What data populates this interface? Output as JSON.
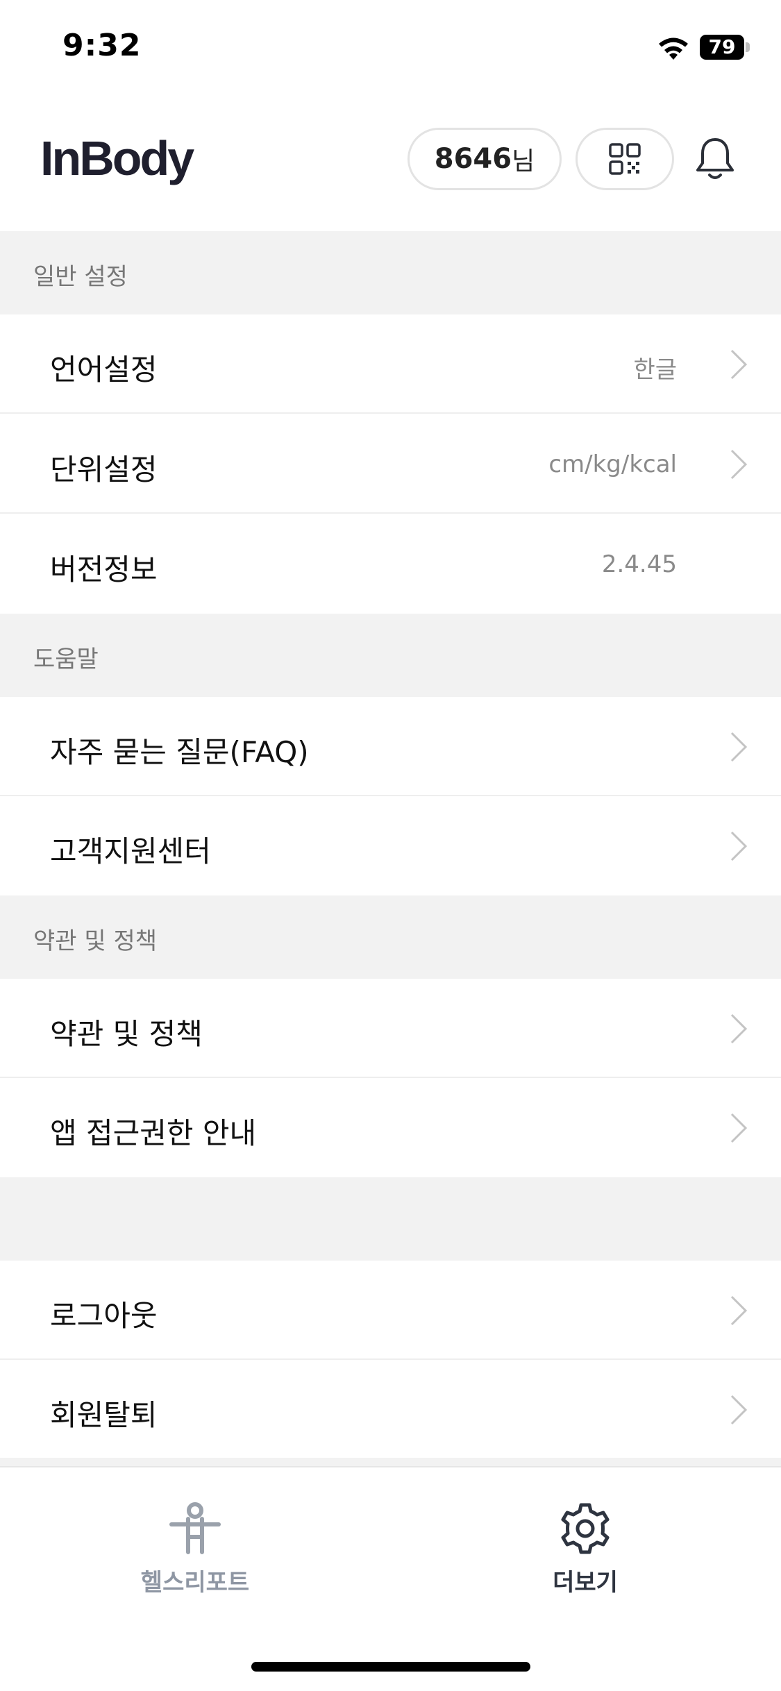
{
  "status_bar": {
    "time": "9:32",
    "battery": "79"
  },
  "header": {
    "logo": "InBody",
    "user_number": "8646",
    "user_suffix": "님"
  },
  "sections": [
    {
      "title": "일반 설정"
    },
    {
      "title": "도움말"
    },
    {
      "title": "약관 및 정책"
    }
  ],
  "rows": {
    "language": {
      "label": "언어설정",
      "value": "한글"
    },
    "units": {
      "label": "단위설정",
      "value": "cm/kg/kcal"
    },
    "version": {
      "label": "버전정보",
      "value": "2.4.45"
    },
    "faq": {
      "label": "자주 묻는 질문(FAQ)"
    },
    "support": {
      "label": "고객지원센터"
    },
    "terms": {
      "label": "약관 및 정책"
    },
    "permissions": {
      "label": "앱 접근권한 안내"
    },
    "logout": {
      "label": "로그아웃"
    },
    "withdraw": {
      "label": "회원탈퇴"
    }
  },
  "bottom_nav": [
    {
      "label": "헬스리포트",
      "icon": "person-icon",
      "active": false
    },
    {
      "label": "더보기",
      "icon": "gear-icon",
      "active": true
    }
  ],
  "colors": {
    "section_bg": "#f2f2f2",
    "inactive_tab": "#8e96a3",
    "active_tab": "#2e3440",
    "logo": "#1f1f2e"
  }
}
